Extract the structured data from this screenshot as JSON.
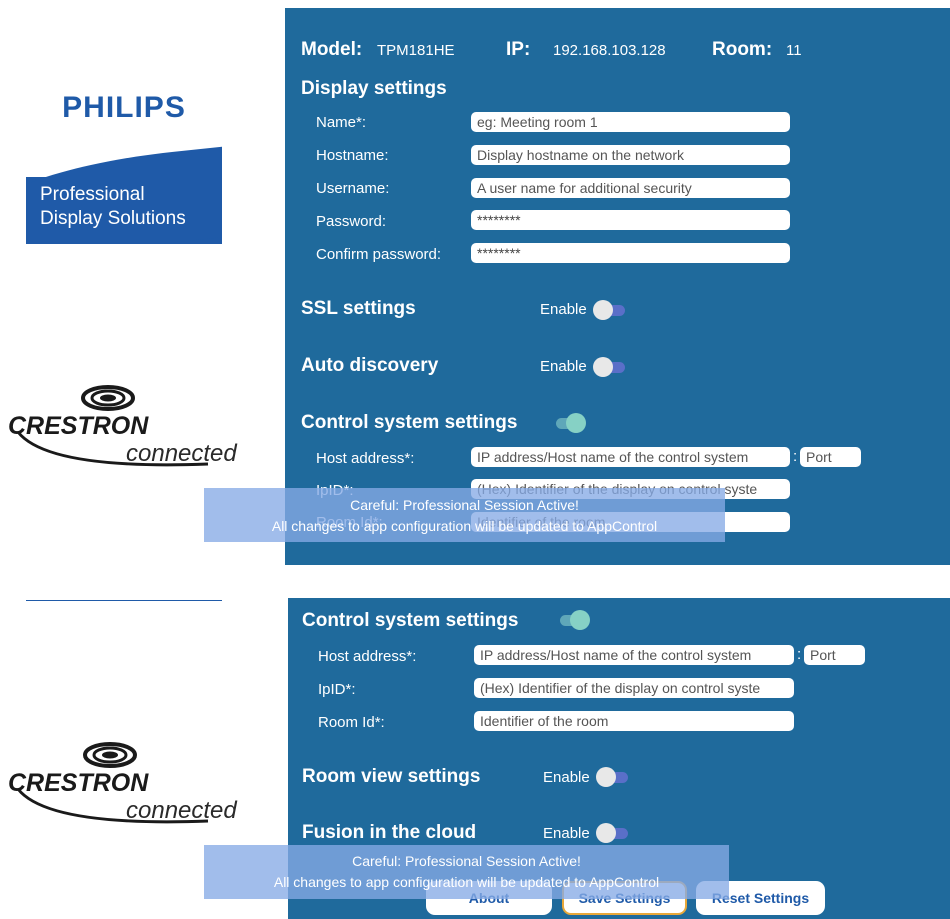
{
  "header": {
    "model_label": "Model:",
    "model_value": "TPM181HE",
    "ip_label": "IP:",
    "ip_value": "192.168.103.128",
    "room_label": "Room:",
    "room_value": "11"
  },
  "display_settings": {
    "title": "Display settings",
    "name_label": "Name*:",
    "name_placeholder": "eg: Meeting room 1",
    "hostname_label": "Hostname:",
    "hostname_placeholder": "Display hostname on the network",
    "username_label": "Username:",
    "username_placeholder": "A user name for additional security",
    "password_label": "Password:",
    "password_value": "********",
    "confirm_label": "Confirm password:",
    "confirm_value": "********"
  },
  "ssl": {
    "title": "SSL settings",
    "enable_label": "Enable",
    "enabled": false
  },
  "auto_discovery": {
    "title": "Auto discovery",
    "enable_label": "Enable",
    "enabled": false
  },
  "control_system": {
    "title": "Control system settings",
    "enabled": true,
    "host_label": "Host address*:",
    "host_placeholder": "IP address/Host name of the control system",
    "colon": ":",
    "port_placeholder": "Port",
    "ipid_label": "IpID*:",
    "ipid_placeholder": "(Hex) Identifier of the display on control syste",
    "roomid_label": "Room Id*:",
    "roomid_placeholder": "Identifier of the room"
  },
  "room_view": {
    "title": "Room view settings",
    "enable_label": "Enable",
    "enabled": false
  },
  "fusion": {
    "title": "Fusion in the cloud",
    "enable_label": "Enable",
    "enabled": false
  },
  "toast": {
    "line1": "Careful: Professional Session Active!",
    "line2": "All changes to app configuration will be updated to AppControl"
  },
  "buttons": {
    "about": "About",
    "save": "Save Settings",
    "reset": "Reset Settings"
  },
  "logos": {
    "philips_word": "PHILIPS",
    "philips_sub1": "Professional",
    "philips_sub2": "Display Solutions",
    "crestron_word": "CRESTRON",
    "crestron_sub": "connected"
  },
  "colors": {
    "panel_bg": "#1f6a9c",
    "philips_blue": "#1f5aa8",
    "toggle_on": "#86d1c5",
    "toast_bg": "#87aae6",
    "focus_border": "#e8a83a"
  }
}
